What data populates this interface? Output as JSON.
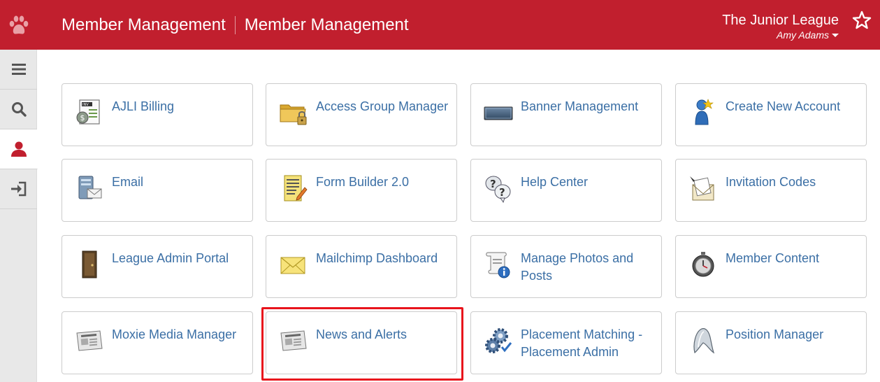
{
  "header": {
    "title_left": "Member Management",
    "title_right": "Member Management",
    "org_name": "The Junior League",
    "user_name": "Amy Adams",
    "brand_color": "#c11f2e"
  },
  "sidebar": {
    "items": [
      {
        "icon": "menu-icon"
      },
      {
        "icon": "search-icon"
      },
      {
        "icon": "user-icon",
        "active": true
      },
      {
        "icon": "logout-icon"
      }
    ]
  },
  "tiles": [
    {
      "label": "AJLI Billing",
      "icon": "invoice-icon"
    },
    {
      "label": "Access Group Manager",
      "icon": "locked-folder-icon"
    },
    {
      "label": "Banner Management",
      "icon": "banner-icon"
    },
    {
      "label": "Create New Account",
      "icon": "new-user-icon"
    },
    {
      "label": "Email",
      "icon": "email-server-icon"
    },
    {
      "label": "Form Builder 2.0",
      "icon": "form-icon"
    },
    {
      "label": "Help Center",
      "icon": "help-icon"
    },
    {
      "label": "Invitation Codes",
      "icon": "invitation-icon"
    },
    {
      "label": "League Admin Portal",
      "icon": "door-icon"
    },
    {
      "label": "Mailchimp Dashboard",
      "icon": "envelope-icon"
    },
    {
      "label": "Manage Photos and Posts",
      "icon": "scroll-info-icon"
    },
    {
      "label": "Member Content",
      "icon": "stopwatch-icon"
    },
    {
      "label": "Moxie Media Manager",
      "icon": "newspaper-icon"
    },
    {
      "label": "News and Alerts",
      "icon": "newspaper-icon"
    },
    {
      "label": "Placement Matching - Placement Admin",
      "icon": "gears-icon"
    },
    {
      "label": "Position Manager",
      "icon": "position-icon"
    }
  ]
}
